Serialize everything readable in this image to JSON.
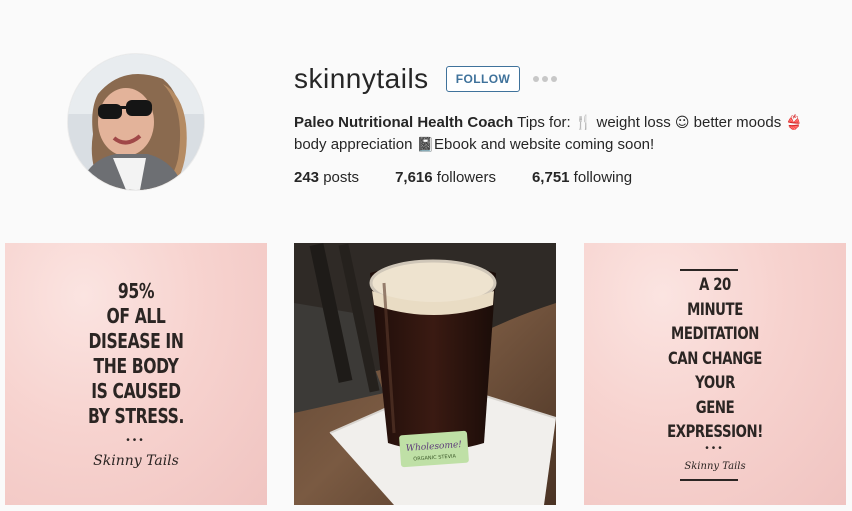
{
  "profile": {
    "username": "skinnytails",
    "follow_label": "FOLLOW",
    "bio_name": "Paleo Nutritional Health Coach",
    "bio_text_1": " Tips for: ",
    "bio_text_2": " weight loss ",
    "bio_text_3": " better moods ",
    "bio_text_4": " body appreciation ",
    "bio_text_5": "Ebook and website coming soon!",
    "emoji_fork_knife": "🍴",
    "emoji_smile": "☺",
    "emoji_bikini": "👙",
    "emoji_book": "📓"
  },
  "stats": {
    "posts_count": "243",
    "posts_label": " posts",
    "followers_count": "7,616",
    "followers_label": " followers",
    "following_count": "6,751",
    "following_label": " following"
  },
  "posts": [
    {
      "lines": [
        "95%",
        "OF ALL",
        "DISEASE IN",
        "THE BODY",
        "IS CAUSED",
        "BY STRESS."
      ],
      "bullets": "•••",
      "signature": "Skinny Tails"
    },
    {
      "packet_text": "Wholesome! ORGANIC STEVIA"
    },
    {
      "lines": [
        "A 20",
        "MINUTE",
        "MEDITATION",
        "CAN CHANGE",
        "YOUR",
        "GENE",
        "EXPRESSION!"
      ],
      "bullets": "•••",
      "signature": "Skinny Tails"
    }
  ],
  "colors": {
    "follow_blue": "#3f729b",
    "background": "#fafafa",
    "post_pink": "#f7d3cf"
  }
}
